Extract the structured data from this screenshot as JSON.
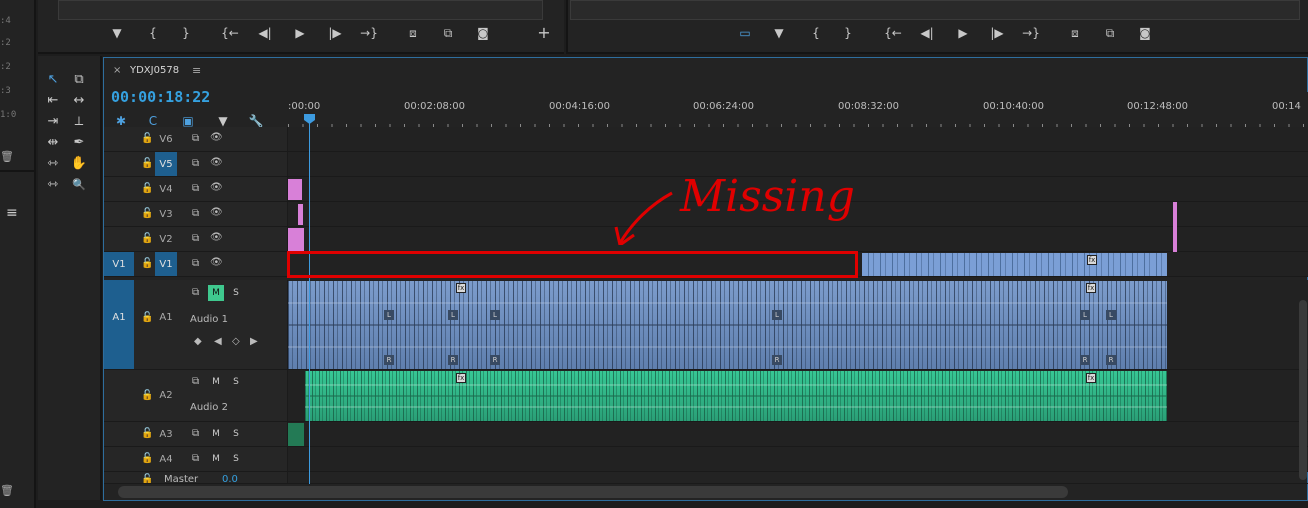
{
  "source_monitor": {
    "buttons": [
      "marker-icon",
      "in-icon",
      "out-icon",
      "go-to-in-icon",
      "step-back-icon",
      "play-icon",
      "step-forward-icon",
      "go-to-out-icon",
      "insert-icon",
      "overwrite-icon",
      "camera-icon",
      "add-icon"
    ],
    "glyphs": [
      "▼",
      "{",
      "}",
      "{←",
      "◀|",
      "▶",
      "|▶",
      "→}",
      "⧈",
      "⧉",
      "◙",
      "+"
    ]
  },
  "program_monitor": {
    "buttons": [
      "comment-icon",
      "marker-icon",
      "in-icon",
      "out-icon",
      "go-to-in-icon",
      "step-back-icon",
      "play-icon",
      "step-forward-icon",
      "go-to-out-icon",
      "lift-icon",
      "extract-icon",
      "camera-icon"
    ],
    "glyphs": [
      "▭",
      "▼",
      "{",
      "}",
      "{←",
      "◀|",
      "▶",
      "|▶",
      "→}",
      "⧈",
      "⧉",
      "◙"
    ]
  },
  "left_strip": {
    "labels": [
      ":4",
      ":2",
      ":2",
      ":3",
      "1:0"
    ]
  },
  "tools": [
    {
      "name": "selection-tool-icon",
      "glyph": "↖",
      "active": true
    },
    {
      "name": "track-select-tool-icon",
      "glyph": "⧉"
    },
    {
      "name": "ripple-edit-tool-icon",
      "glyph": "⇤"
    },
    {
      "name": "rolling-edit-tool-icon",
      "glyph": "↔"
    },
    {
      "name": "rate-stretch-tool-icon",
      "glyph": "⇥"
    },
    {
      "name": "razor-tool-icon",
      "glyph": "⟂"
    },
    {
      "name": "slip-tool-icon",
      "glyph": "⇹"
    },
    {
      "name": "pen-tool-icon",
      "glyph": "✒"
    },
    {
      "name": "slide-tool-icon",
      "glyph": "⇿"
    },
    {
      "name": "hand-tool-icon",
      "glyph": "✋"
    },
    {
      "name": "zoom-tool-icon",
      "glyph": "🔍"
    }
  ],
  "timeline": {
    "tab_close": "×",
    "sequence_name": "YDXJ0578",
    "tab_menu": "≡",
    "timecode": "00:00:18:22",
    "ruler_labels": [
      ":00:00",
      "00:02:08:00",
      "00:04:16:00",
      "00:06:24:00",
      "00:08:32:00",
      "00:10:40:00",
      "00:12:48:00",
      "00:14"
    ],
    "video_tracks": [
      {
        "name": "V6",
        "targeted": false
      },
      {
        "name": "V5",
        "targeted": true
      },
      {
        "name": "V4",
        "targeted": false
      },
      {
        "name": "V3",
        "targeted": false
      },
      {
        "name": "V2",
        "targeted": false
      },
      {
        "name": "V1",
        "targeted": true,
        "source": "V1"
      }
    ],
    "audio_tracks": [
      {
        "name": "A1",
        "source": "A1",
        "label": "Audio 1",
        "mute": "M",
        "solo": "S",
        "mute_active": true
      },
      {
        "name": "A2",
        "label": "Audio 2",
        "mute": "M",
        "solo": "S"
      },
      {
        "name": "A3",
        "mute": "M",
        "solo": "S"
      },
      {
        "name": "A4",
        "mute": "M",
        "solo": "S"
      }
    ],
    "master": {
      "name": "Master",
      "value": "0.0"
    },
    "channel_labels": [
      "L",
      "R"
    ],
    "fx_label": "fx"
  },
  "annotation": {
    "text": "Missing",
    "color": "#e00000"
  },
  "colors": {
    "accent": "#35a1e0",
    "video_clip": "#7b9fd6",
    "audio1_clip": "#7c9ccc",
    "audio2_clip": "#37c895",
    "graphic_clip": "#d880d8",
    "work_area": "#e6e22b"
  }
}
